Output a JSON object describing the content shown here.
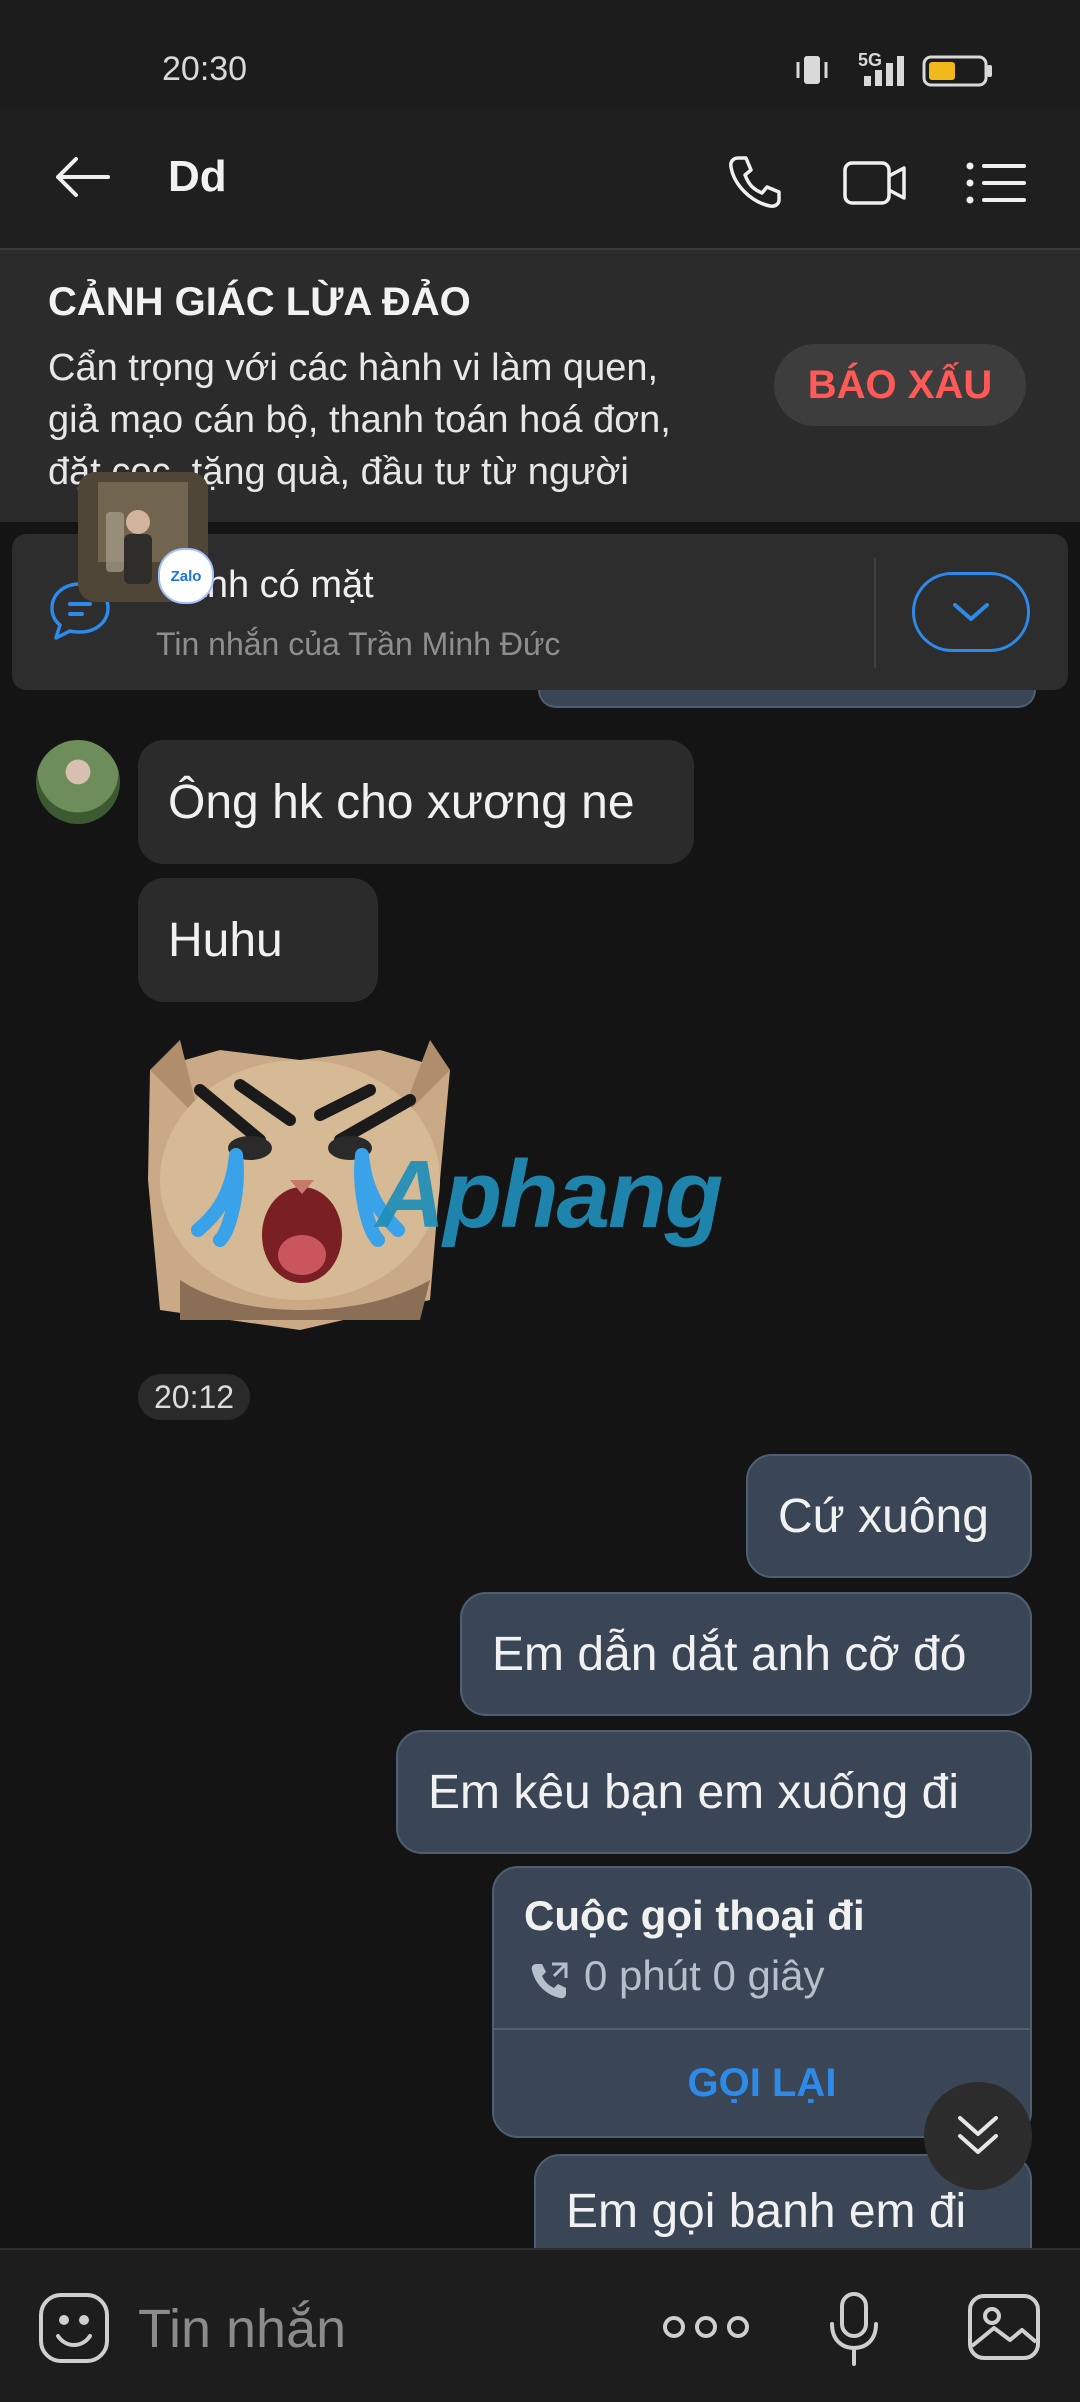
{
  "status_bar": {
    "time": "20:30",
    "network": "5G"
  },
  "header": {
    "title": "Dd"
  },
  "warning": {
    "title": "CẢNH GIÁC LỪA ĐẢO",
    "line1": "Cẩn trọng với các hành vi làm quen,",
    "line2": "giả mạo cán bộ, thanh toán hoá đơn,",
    "line3": "đặt cọc, tặng quà, đầu tư từ người",
    "report_label": "BÁO XẤU"
  },
  "pinned": {
    "text": "n anh có mặt",
    "sender": "Tin nhắn của Trần Minh Đức",
    "badge": "Zalo"
  },
  "messages": {
    "in1": "Ông hk cho xương ne",
    "in2": "Huhu",
    "time": "20:12",
    "out1": "Cứ xuông",
    "out2": "Em dẫn dắt anh cỡ đó",
    "out3": "Em kêu bạn em xuống đi",
    "out4": "Em gọi banh em đi"
  },
  "call_card": {
    "title": "Cuộc gọi thoại đi",
    "duration": "0 phút 0 giây",
    "callback": "GỌI LẠI"
  },
  "watermark": "Aphang",
  "input": {
    "placeholder": "Tin nhắn"
  },
  "colors": {
    "accent": "#2d8ae8",
    "danger": "#ff5a57",
    "outgoing_bubble": "#3a4655",
    "incoming_bubble": "#2b2b2b"
  }
}
